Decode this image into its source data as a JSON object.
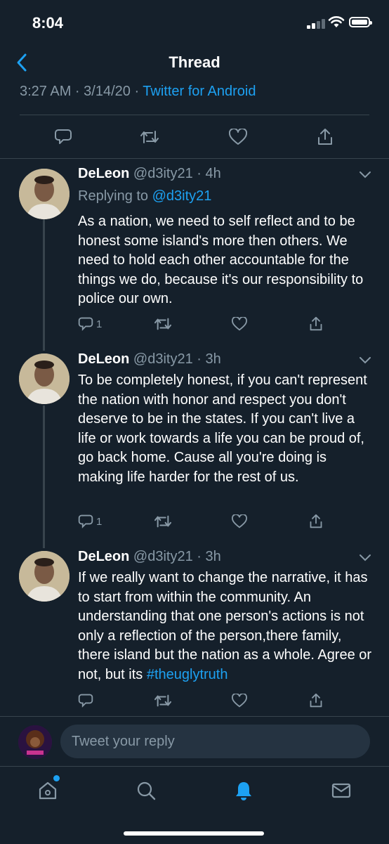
{
  "status_bar": {
    "time": "8:04"
  },
  "nav": {
    "title": "Thread"
  },
  "main_tweet": {
    "timestamp": "3:27 AM · 3/14/20 · ",
    "source": "Twitter for Android"
  },
  "tweets": [
    {
      "name": "DeLeon",
      "handle": "@d3ity21 · 4h",
      "replying_label": "Replying to ",
      "replying_to": "@d3ity21",
      "body": "As a nation, we need to self reflect and to be honest some island's more then others. We need to hold each other accountable for the things we do, because it's our responsibility to police our own.",
      "reply_count": "1"
    },
    {
      "name": "DeLeon",
      "handle": "@d3ity21 · 3h",
      "body": "To be completely honest, if you can't represent the nation with honor and respect you don't deserve to be in the states. If you can't live a life or work towards a life you can be proud of, go back home. Cause all you're doing is making life harder for the rest of us.",
      "reply_count": "1"
    },
    {
      "name": "DeLeon",
      "handle": "@d3ity21 · 3h",
      "body": "If we really want to change the narrative, it has to start from within the community. An understanding that one person's actions is not only a reflection of the person,there family, there island but the nation as a whole. Agree or not, but its ",
      "hashtag": "#theuglytruth"
    }
  ],
  "composer": {
    "placeholder": "Tweet your reply"
  },
  "icons": {
    "back": "chevron-left-icon",
    "reply": "reply-icon",
    "retweet": "retweet-icon",
    "like": "heart-icon",
    "share": "share-icon",
    "home": "home-icon",
    "search": "search-icon",
    "notifications": "bell-icon",
    "messages": "mail-icon"
  },
  "colors": {
    "background": "#15202b",
    "accent": "#1da1f2",
    "secondary_text": "#8899a6",
    "divider": "#38444d"
  }
}
